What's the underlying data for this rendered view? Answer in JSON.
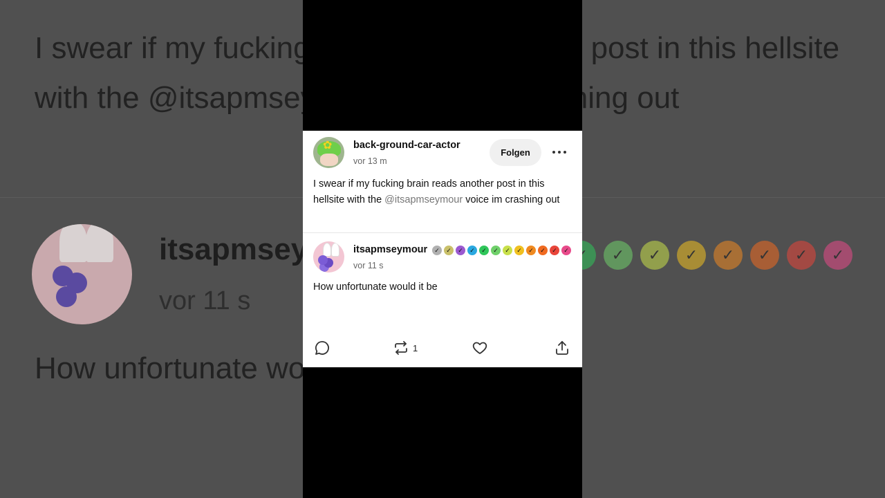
{
  "background": {
    "post_text": "I swear if my fucking brain reads another post in this hellsite with the @itsapmseymour voice im crashing out",
    "reply_username": "itsapmseymour",
    "reply_time": "vor 11 s",
    "reply_text": "How unfortunate would it be"
  },
  "post": {
    "username": "back-ground-car-actor",
    "time": "vor 13 m",
    "follow_label": "Folgen",
    "text_before": "I swear if my fucking brain reads another post in this hellsite with the ",
    "mention": "@itsapmseymour",
    "text_after": " voice im crashing out"
  },
  "reply": {
    "username": "itsapmseymour",
    "time": "vor 11 s",
    "text": "How unfortunate would it be",
    "badges": [
      "#b0b0b0",
      "#c9c06a",
      "#9b59d0",
      "#2aa8e0",
      "#2fc65a",
      "#6fd06a",
      "#c8e04a",
      "#f0c020",
      "#f08a20",
      "#f06a20",
      "#e8453a",
      "#e84a8a"
    ]
  },
  "actions": {
    "reblog_count": "1"
  },
  "icons": {
    "comment": "comment-icon",
    "reblog": "reblog-icon",
    "like": "heart-icon",
    "share": "share-icon",
    "more": "more-icon"
  }
}
